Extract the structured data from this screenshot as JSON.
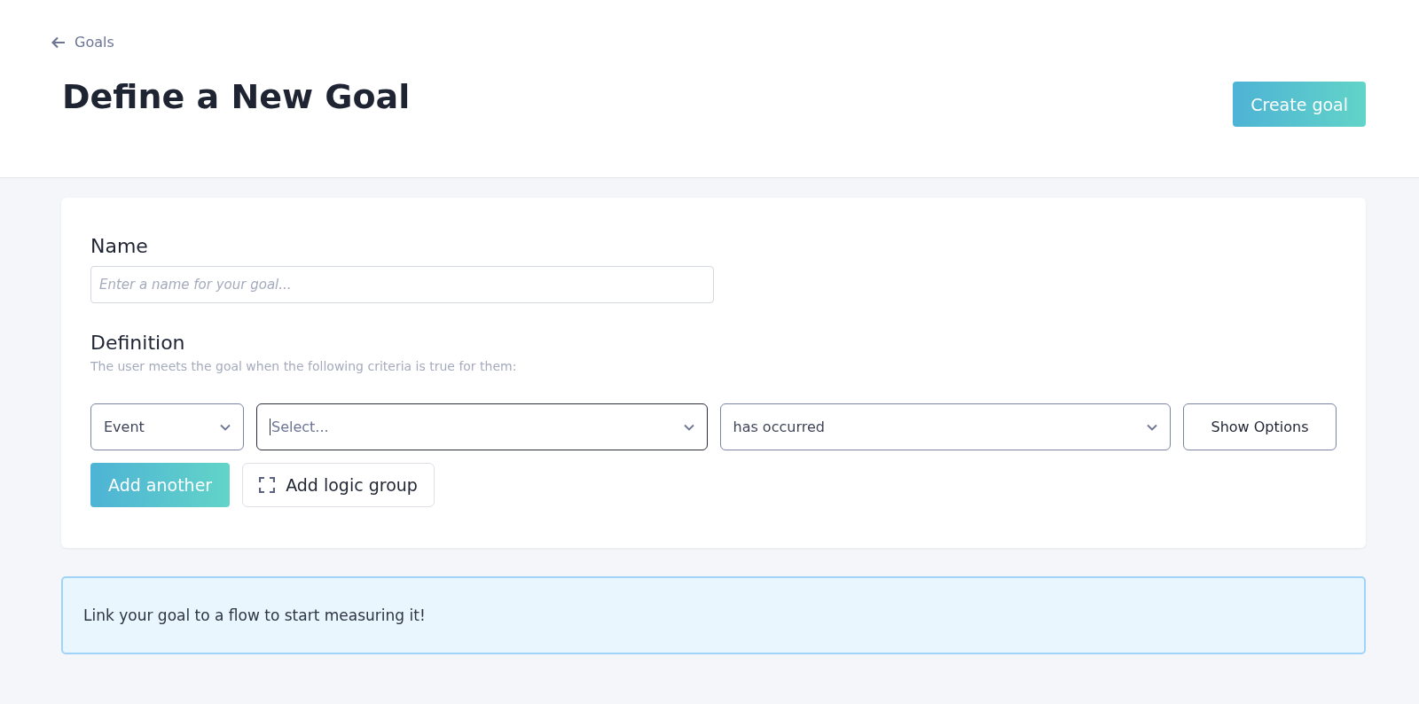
{
  "header": {
    "back_link": "Goals",
    "title": "Define a New Goal",
    "primary_button": "Create goal"
  },
  "form": {
    "name_label": "Name",
    "name_placeholder": "Enter a name for your goal...",
    "definition_label": "Definition",
    "definition_hint": "The user meets the goal when the following criteria is true for them:",
    "criteria": [
      {
        "kind": "dropdown",
        "value": "Event",
        "focused": false
      },
      {
        "kind": "dropdown",
        "placeholder": "Select...",
        "focused": true
      },
      {
        "kind": "dropdown",
        "value": "has occurred",
        "focused": false
      },
      {
        "kind": "button",
        "label": "Show Options"
      }
    ],
    "actions": [
      {
        "kind": "primary",
        "label": "Add another"
      },
      {
        "kind": "group",
        "label": "Add logic group"
      }
    ]
  },
  "banner": {
    "text": "Link your goal to a flow to start measuring it!"
  }
}
